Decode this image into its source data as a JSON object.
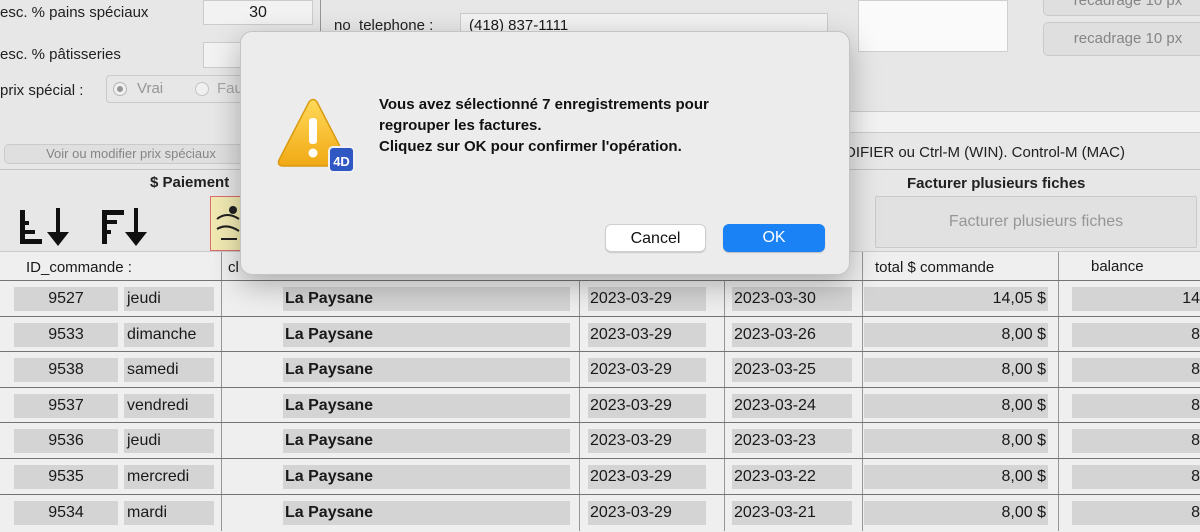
{
  "settings": {
    "discount_bread_label": "esc. % pains spéciaux",
    "discount_bread_value": "30",
    "discount_pastry_label": "esc. % pâtisseries",
    "discount_pastry_value": "",
    "special_price_label": "prix spécial :",
    "radio_true": "Vrai",
    "radio_false": "Faux",
    "view_special_price_button": "Voir ou modifier prix spéciaux"
  },
  "contact": {
    "phone_label": "no_telephone :",
    "phone_value": "(418) 837-1111"
  },
  "crop_buttons": [
    "recadrage 10 px",
    "recadrage 10 px"
  ],
  "shortcut_hint": "DIFIER ou Ctrl-M (WIN). Control-M (MAC)",
  "payment_header": "$ Paiement",
  "invoice_multi": {
    "title": "Facturer plusieurs fiches",
    "button": "Facturer plusieurs fiches"
  },
  "table": {
    "headers": {
      "id": "ID_commande :",
      "client": "cl",
      "total": "total $ commande",
      "balance": "balance"
    },
    "rows": [
      {
        "id": "9527",
        "day": "jeudi",
        "client": "La Paysane",
        "date1": "2023-03-29",
        "date2": "2023-03-30",
        "total": "14,05 $",
        "balance": "14"
      },
      {
        "id": "9533",
        "day": "dimanche",
        "client": "La Paysane",
        "date1": "2023-03-29",
        "date2": "2023-03-26",
        "total": "8,00 $",
        "balance": "8"
      },
      {
        "id": "9538",
        "day": "samedi",
        "client": "La Paysane",
        "date1": "2023-03-29",
        "date2": "2023-03-25",
        "total": "8,00 $",
        "balance": "8"
      },
      {
        "id": "9537",
        "day": "vendredi",
        "client": "La Paysane",
        "date1": "2023-03-29",
        "date2": "2023-03-24",
        "total": "8,00 $",
        "balance": "8"
      },
      {
        "id": "9536",
        "day": "jeudi",
        "client": "La Paysane",
        "date1": "2023-03-29",
        "date2": "2023-03-23",
        "total": "8,00 $",
        "balance": "8"
      },
      {
        "id": "9535",
        "day": "mercredi",
        "client": "La Paysane",
        "date1": "2023-03-29",
        "date2": "2023-03-22",
        "total": "8,00 $",
        "balance": "8"
      },
      {
        "id": "9534",
        "day": "mardi",
        "client": "La Paysane",
        "date1": "2023-03-29",
        "date2": "2023-03-21",
        "total": "8,00 $",
        "balance": "8"
      }
    ]
  },
  "dialog": {
    "line1": "Vous avez sélectionné 7 enregistrements pour",
    "line2": "regrouper les factures.",
    "line3": "Cliquez sur OK pour confirmer l'opération.",
    "cancel": "Cancel",
    "ok": "OK",
    "badge": "4D",
    "accent": "#1a82f5"
  }
}
